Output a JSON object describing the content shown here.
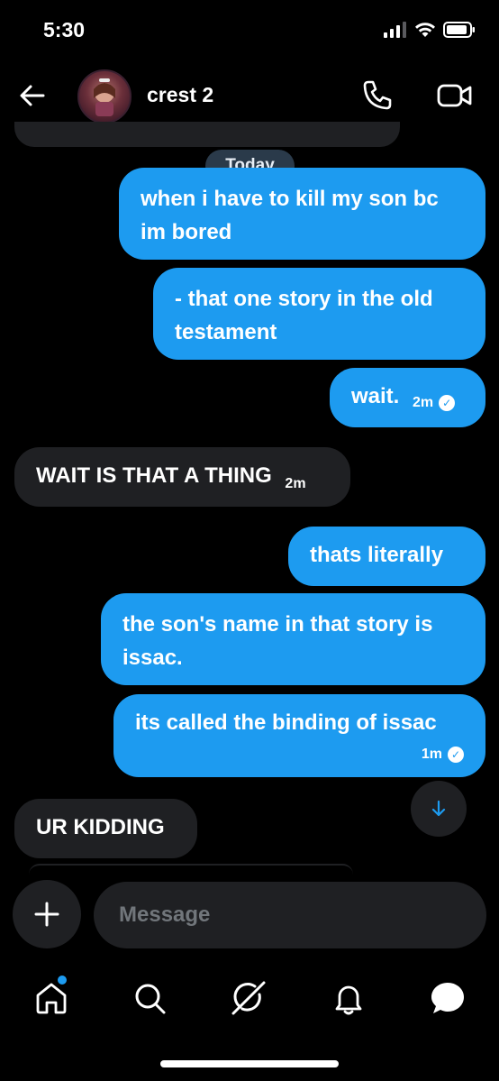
{
  "status_bar": {
    "time": "5:30"
  },
  "header": {
    "contact_name": "crest 2"
  },
  "date_divider": "Today",
  "messages": [
    {
      "direction": "out",
      "text": "when i have to kill my son bc im bored"
    },
    {
      "direction": "out",
      "text": "- that one story in the old testament"
    },
    {
      "direction": "out",
      "text": "wait.",
      "time": "2m",
      "read": true
    },
    {
      "direction": "in",
      "text": "WAIT IS THAT A THING",
      "time": "2m"
    },
    {
      "direction": "out",
      "text": "thats literally"
    },
    {
      "direction": "out",
      "text": "the son's name in that story is issac."
    },
    {
      "direction": "out",
      "text": "its called the binding of issac",
      "time": "1m",
      "read": true
    },
    {
      "direction": "in",
      "text": "UR KIDDING"
    }
  ],
  "composer": {
    "placeholder": "Message"
  },
  "bottom_nav": {
    "items": [
      "home-icon",
      "search-icon",
      "grok-icon",
      "notifications-icon",
      "messages-icon"
    ],
    "home_has_badge": true
  },
  "colors": {
    "outgoing": "#1d9bf0",
    "incoming": "#1f2023",
    "background": "#000000"
  }
}
